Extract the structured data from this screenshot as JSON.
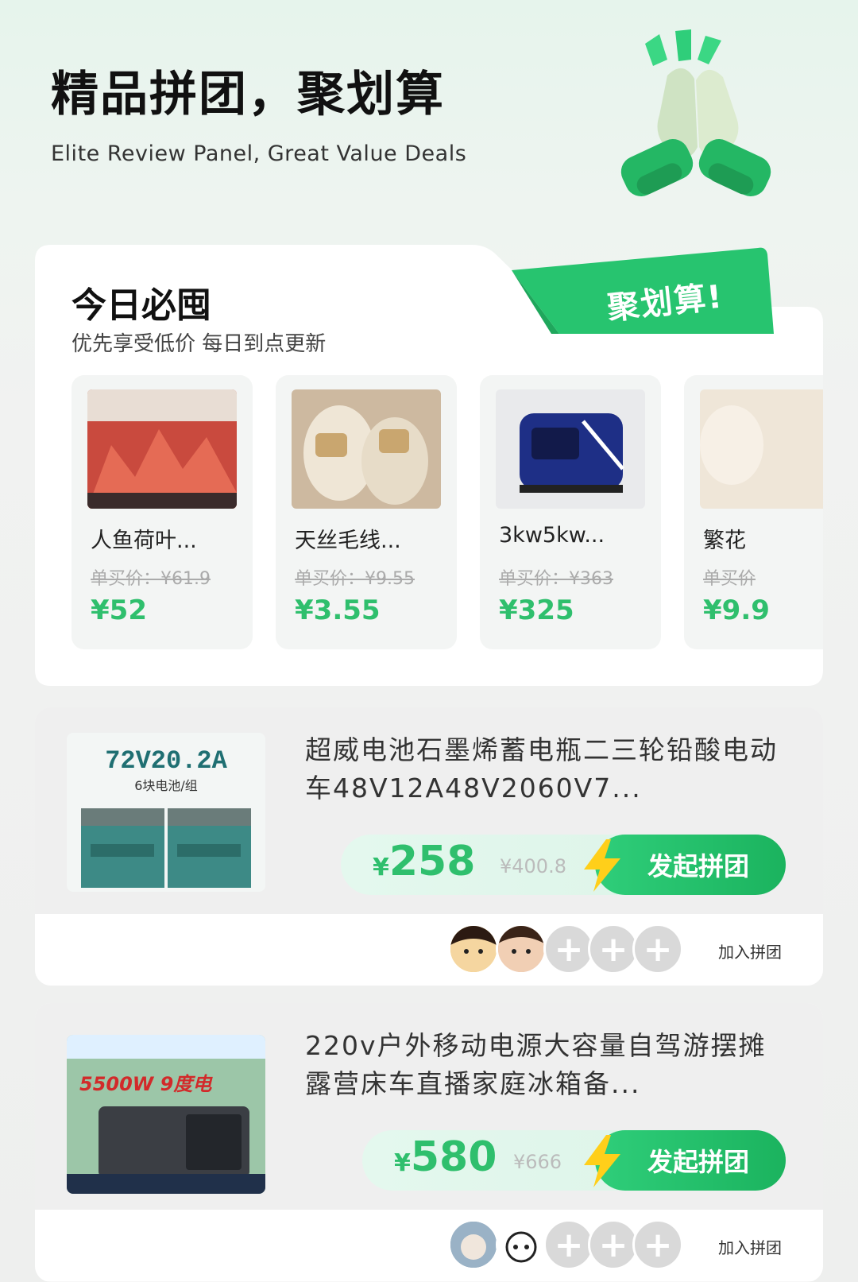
{
  "header": {
    "title": "精品拼团，聚划算",
    "subtitle": "Elite Review Panel, Great Value Deals",
    "icon": "praying-hands-icon"
  },
  "today": {
    "title": "今日必囤",
    "subtitle": "优先享受低价 每日到点更新",
    "ribbon": "聚划算!",
    "items": [
      {
        "name": "人鱼荷叶...",
        "orig": "单买价：¥61.9",
        "price": "¥52"
      },
      {
        "name": "天丝毛线...",
        "orig": "单买价：¥9.55",
        "price": "¥3.55"
      },
      {
        "name": "3kw5kw...",
        "orig": "单买价：¥363",
        "price": "¥325"
      },
      {
        "name": "繁花",
        "orig": "单买价",
        "price": "¥9.9"
      }
    ]
  },
  "products": [
    {
      "title": "超威电池石墨烯蓄电瓶二三轮铅酸电动车48V12A48V2060V7...",
      "img_title": "72V20.2A",
      "img_sub": "6块电池/组",
      "price": "258",
      "orig": "¥400.8",
      "button": "发起拼团",
      "join": "加入拼团"
    },
    {
      "title": "220v户外移动电源大容量自驾游摆摊露营床车直播家庭冰箱备...",
      "img_title": "5500W 9度电",
      "price": "580",
      "orig": "¥666",
      "button": "发起拼团",
      "join": "加入拼团"
    }
  ],
  "colors": {
    "accent": "#2fbf6d",
    "ribbon": "#27c46f"
  }
}
